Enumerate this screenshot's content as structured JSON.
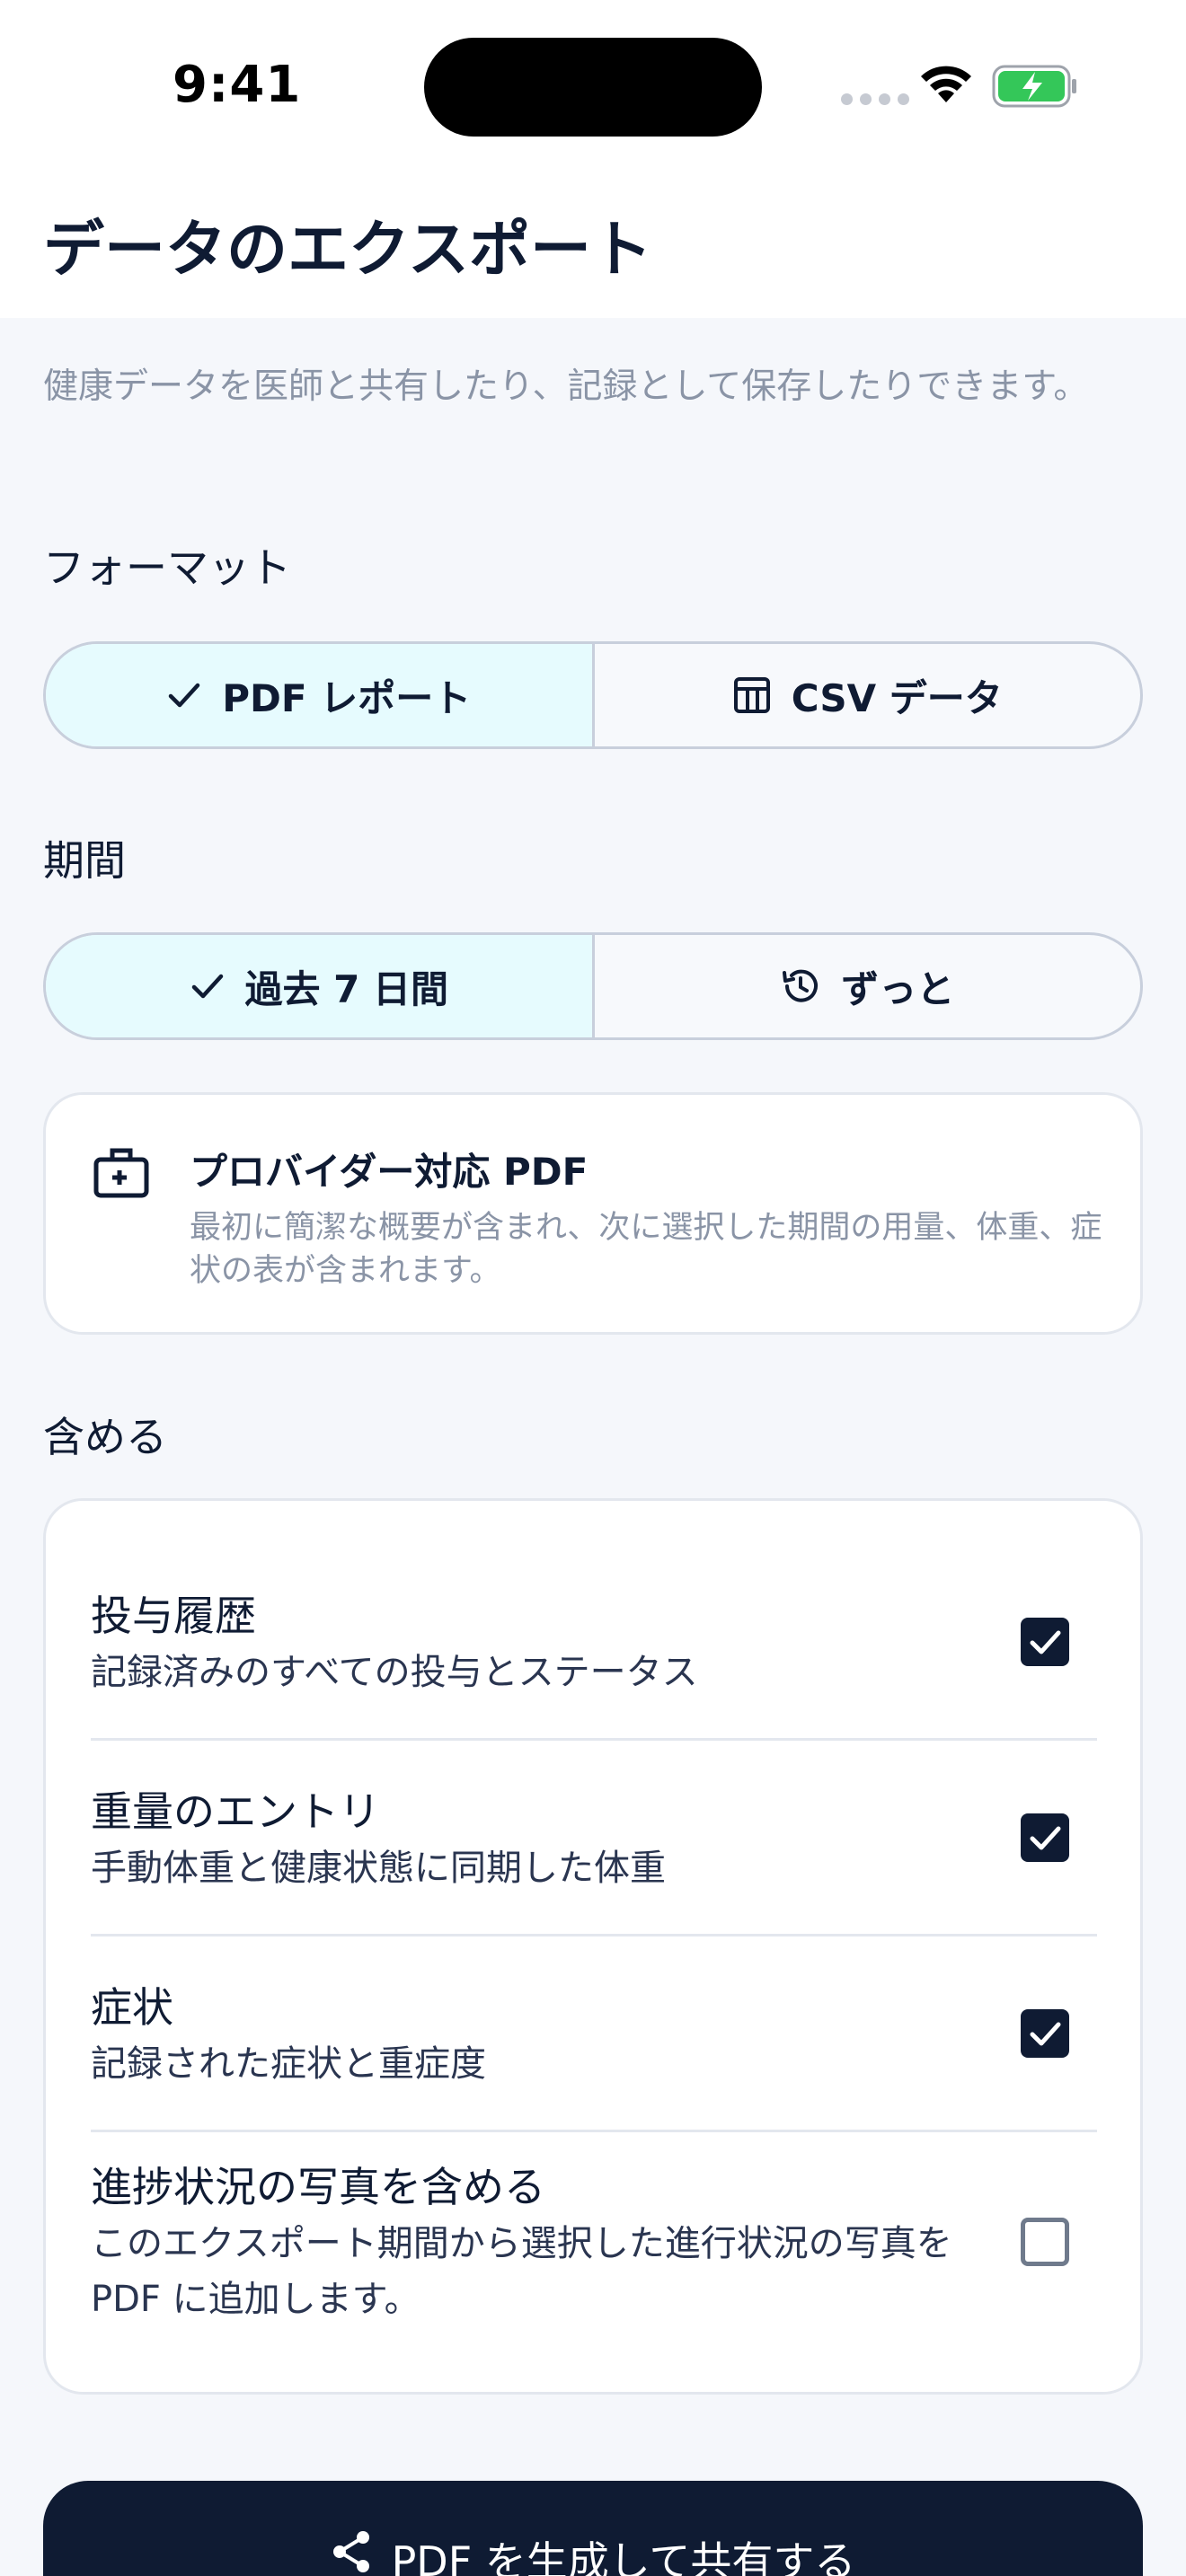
{
  "status": {
    "time": "9:41"
  },
  "header": {
    "title": "データのエクスポート"
  },
  "description": "健康データを医師と共有したり、記録として保存したりできます。",
  "format": {
    "label": "フォーマット",
    "options": [
      {
        "label": "PDF レポート",
        "icon": "checkmark-icon",
        "selected": true
      },
      {
        "label": "CSV データ",
        "icon": "table-icon",
        "selected": false
      }
    ]
  },
  "period": {
    "label": "期間",
    "options": [
      {
        "label": "過去 7 日間",
        "icon": "checkmark-icon",
        "selected": true
      },
      {
        "label": "ずっと",
        "icon": "history-icon",
        "selected": false
      }
    ]
  },
  "info": {
    "title": "プロバイダー対応 PDF",
    "body": "最初に簡潔な概要が含まれ、次に選択した期間の用量、体重、症状の表が含まれます。"
  },
  "include": {
    "label": "含める",
    "items": [
      {
        "title": "投与履歴",
        "subtitle": "記録済みのすべての投与とステータス",
        "checked": true
      },
      {
        "title": "重量のエントリ",
        "subtitle": "手動体重と健康状態に同期した体重",
        "checked": true
      },
      {
        "title": "症状",
        "subtitle": "記録された症状と重症度",
        "checked": true
      },
      {
        "title": "進捗状況の写真を含める",
        "subtitle": "このエクスポート期間から選択した進行状況の写真を PDF に追加します。",
        "checked": false
      }
    ]
  },
  "cta": {
    "label": "PDF を生成して共有する",
    "icon": "share-icon"
  },
  "colors": {
    "primary": "#0f1b33",
    "selected_bg": "#e6fbfe",
    "muted_text": "#8a94a6",
    "background": "#f5f7fb",
    "battery": "#34c759"
  }
}
